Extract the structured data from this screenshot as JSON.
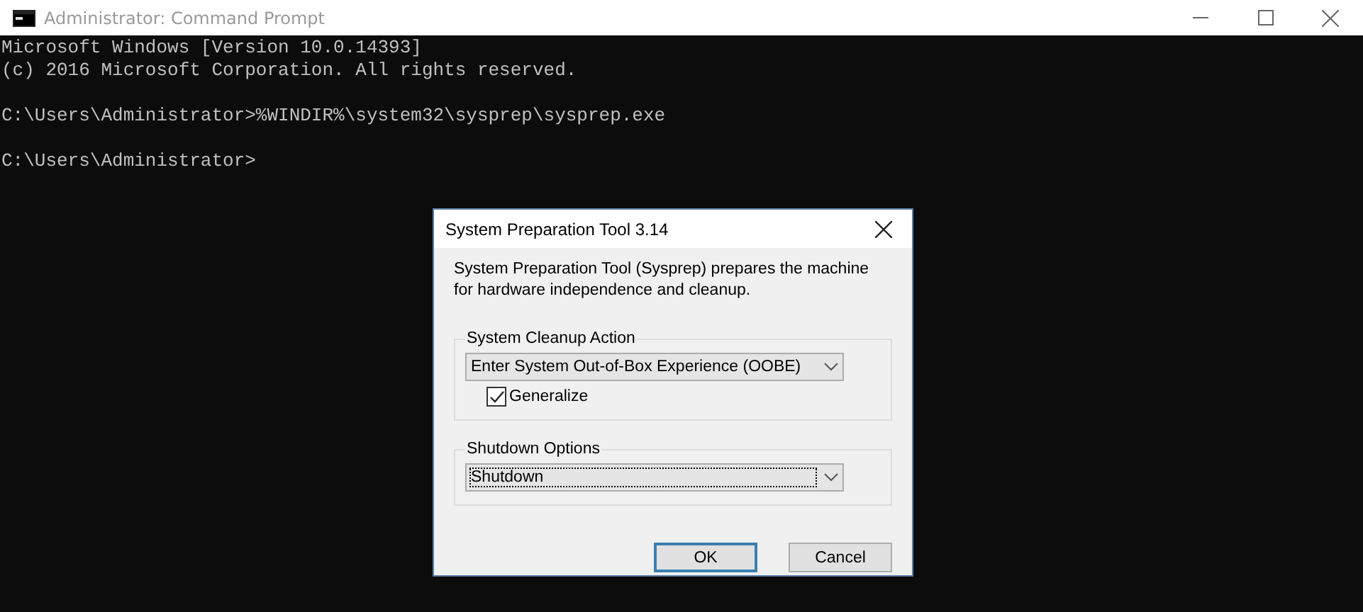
{
  "window": {
    "title": "Administrator: Command Prompt"
  },
  "console": {
    "blocks": [
      [
        "Microsoft Windows [Version 10.0.14393]",
        "(c) 2016 Microsoft Corporation. All rights reserved."
      ],
      [
        "C:\\Users\\Administrator>%WINDIR%\\system32\\sysprep\\sysprep.exe"
      ],
      [
        "C:\\Users\\Administrator>"
      ]
    ]
  },
  "dialog": {
    "title": "System Preparation Tool 3.14",
    "description": "System Preparation Tool (Sysprep) prepares the machine for hardware independence and cleanup.",
    "cleanup": {
      "label": "System Cleanup Action",
      "value": "Enter System Out-of-Box Experience (OOBE)",
      "generalize": {
        "label": "Generalize",
        "checked": true
      }
    },
    "shutdown": {
      "label": "Shutdown Options",
      "value": "Shutdown",
      "focused": true
    },
    "buttons": [
      {
        "label": "OK",
        "default": true
      },
      {
        "label": "Cancel",
        "default": false
      }
    ]
  }
}
